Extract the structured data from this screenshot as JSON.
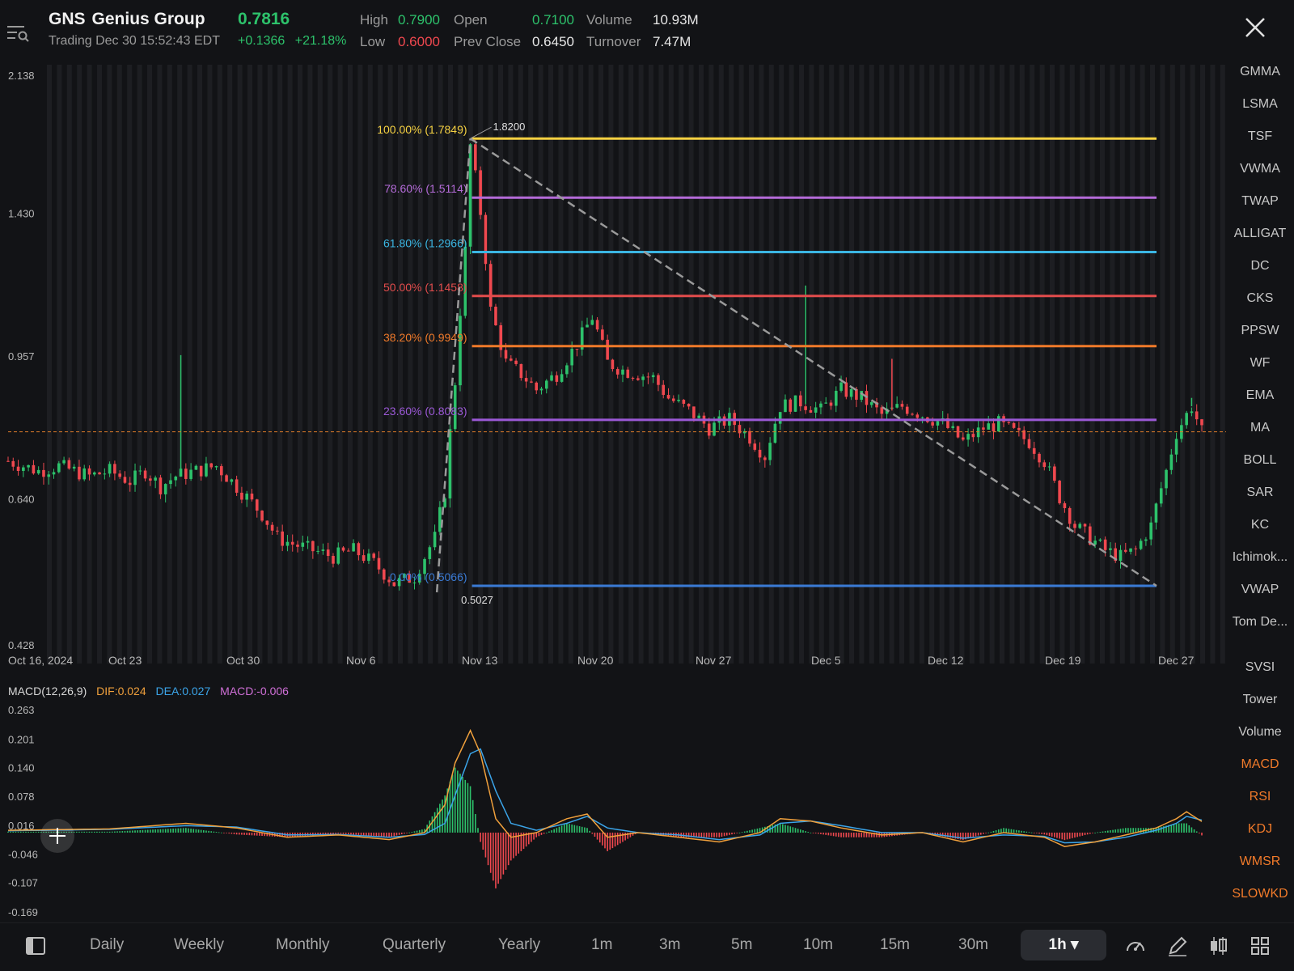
{
  "header": {
    "symbol": "GNS",
    "company": "Genius Group",
    "price": "0.7816",
    "status": "Trading Dec 30 15:52:43 EDT",
    "change": "+0.1366",
    "change_pct": "+21.18%",
    "high_label": "High",
    "high": "0.7900",
    "low_label": "Low",
    "low": "0.6000",
    "open_label": "Open",
    "open": "0.7100",
    "prev_close_label": "Prev Close",
    "prev_close": "0.6450",
    "volume_label": "Volume",
    "volume": "10.93M",
    "turnover_label": "Turnover",
    "turnover": "7.47M"
  },
  "chart_data": [
    {
      "type": "candlestick",
      "y_axis_ticks": [
        "2.138",
        "1.430",
        "0.957",
        "0.640",
        "0.428"
      ],
      "y_axis_tick_values": [
        2.138,
        1.43,
        0.957,
        0.64,
        0.428
      ],
      "log_scale": true,
      "ylim": [
        0.428,
        2.138
      ],
      "x_axis_ticks": [
        "Oct 16, 2024",
        "Oct 23",
        "Oct 30",
        "Nov 6",
        "Nov 13",
        "Nov 20",
        "Nov 27",
        "Dec 5",
        "Dec 12",
        "Dec 19",
        "Dec 27"
      ],
      "current_price_line": 0.7816,
      "fibonacci": [
        {
          "label": "100.00% (1.7849)",
          "value": 1.7849,
          "color": "#f5d142"
        },
        {
          "label": "78.60% (1.5114)",
          "value": 1.5114,
          "color": "#b46bd8"
        },
        {
          "label": "61.80% (1.2966)",
          "value": 1.2966,
          "color": "#3bb6e3"
        },
        {
          "label": "50.00% (1.1458)",
          "value": 1.1458,
          "color": "#e24c4c"
        },
        {
          "label": "38.20% (0.9949)",
          "value": 0.9949,
          "color": "#f07a2a"
        },
        {
          "label": "23.60% (0.8083)",
          "value": 0.8083,
          "color": "#9b59d6"
        },
        {
          "label": "0.00% (0.5066)",
          "value": 0.5066,
          "color": "#3a7bd5"
        }
      ],
      "swing_high_label": "1.8200",
      "swing_low_label": "0.5027",
      "price_path": [
        [
          0,
          0.72
        ],
        [
          6,
          0.7
        ],
        [
          10,
          0.71
        ],
        [
          16,
          0.69
        ],
        [
          20,
          0.7
        ],
        [
          24,
          0.68
        ],
        [
          27,
          0.7
        ],
        [
          30,
          0.67
        ],
        [
          33,
          0.69
        ],
        [
          37,
          0.7
        ],
        [
          41,
          0.71
        ],
        [
          44,
          0.68
        ],
        [
          47,
          0.65
        ],
        [
          50,
          0.62
        ],
        [
          53,
          0.58
        ],
        [
          56,
          0.57
        ],
        [
          60,
          0.56
        ],
        [
          64,
          0.55
        ],
        [
          68,
          0.56
        ],
        [
          72,
          0.54
        ],
        [
          76,
          0.51
        ],
        [
          80,
          0.52
        ],
        [
          84,
          0.58
        ],
        [
          86,
          0.66
        ],
        [
          88,
          0.9
        ],
        [
          90,
          1.3
        ],
        [
          91,
          1.75
        ],
        [
          93,
          1.45
        ],
        [
          95,
          1.1
        ],
        [
          98,
          0.95
        ],
        [
          101,
          0.92
        ],
        [
          104,
          0.88
        ],
        [
          108,
          0.92
        ],
        [
          112,
          1.0
        ],
        [
          115,
          1.08
        ],
        [
          118,
          0.95
        ],
        [
          121,
          0.93
        ],
        [
          124,
          0.92
        ],
        [
          127,
          0.91
        ],
        [
          130,
          0.86
        ],
        [
          134,
          0.83
        ],
        [
          138,
          0.79
        ],
        [
          142,
          0.81
        ],
        [
          146,
          0.77
        ],
        [
          149,
          0.73
        ],
        [
          152,
          0.84
        ],
        [
          156,
          0.85
        ],
        [
          160,
          0.83
        ],
        [
          164,
          0.88
        ],
        [
          168,
          0.86
        ],
        [
          172,
          0.82
        ],
        [
          176,
          0.84
        ],
        [
          180,
          0.82
        ],
        [
          184,
          0.8
        ],
        [
          188,
          0.76
        ],
        [
          192,
          0.79
        ],
        [
          195,
          0.8
        ],
        [
          198,
          0.78
        ],
        [
          201,
          0.76
        ],
        [
          204,
          0.72
        ],
        [
          207,
          0.65
        ],
        [
          210,
          0.6
        ],
        [
          213,
          0.58
        ],
        [
          216,
          0.56
        ],
        [
          219,
          0.55
        ],
        [
          222,
          0.56
        ],
        [
          225,
          0.6
        ],
        [
          228,
          0.7
        ],
        [
          230,
          0.78
        ],
        [
          233,
          0.84
        ],
        [
          235,
          0.7816
        ]
      ],
      "spikes": [
        [
          34,
          0.97
        ],
        [
          157,
          1.18
        ],
        [
          174,
          0.96
        ],
        [
          233,
          0.86
        ]
      ]
    },
    {
      "type": "macd",
      "indicator": "MACD(12,26,9)",
      "dif_label": "DIF:0.024",
      "dea_label": "DEA:0.027",
      "macd_label": "MACD:-0.006",
      "dif_color": "#f0a03c",
      "dea_color": "#3ba4e8",
      "macd_color": "#d070d8",
      "y_axis_ticks": [
        "0.263",
        "0.201",
        "0.140",
        "0.078",
        "0.016",
        "-0.046",
        "-0.107",
        "-0.169"
      ],
      "ylim": [
        -0.169,
        0.263
      ],
      "dif_path": [
        [
          0,
          0.005
        ],
        [
          20,
          0.008
        ],
        [
          35,
          0.02
        ],
        [
          45,
          0.01
        ],
        [
          55,
          -0.01
        ],
        [
          65,
          -0.005
        ],
        [
          75,
          -0.015
        ],
        [
          82,
          0.0
        ],
        [
          86,
          0.06
        ],
        [
          88,
          0.15
        ],
        [
          91,
          0.22
        ],
        [
          93,
          0.17
        ],
        [
          96,
          0.03
        ],
        [
          99,
          -0.01
        ],
        [
          104,
          0.0
        ],
        [
          110,
          0.03
        ],
        [
          114,
          0.04
        ],
        [
          118,
          -0.01
        ],
        [
          124,
          0.0
        ],
        [
          132,
          -0.01
        ],
        [
          140,
          -0.02
        ],
        [
          148,
          0.0
        ],
        [
          152,
          0.03
        ],
        [
          158,
          0.025
        ],
        [
          164,
          0.01
        ],
        [
          172,
          -0.005
        ],
        [
          180,
          0.0
        ],
        [
          188,
          -0.02
        ],
        [
          196,
          0.0
        ],
        [
          204,
          -0.01
        ],
        [
          208,
          -0.03
        ],
        [
          214,
          -0.02
        ],
        [
          220,
          -0.005
        ],
        [
          226,
          0.01
        ],
        [
          230,
          0.03
        ],
        [
          232,
          0.045
        ],
        [
          235,
          0.024
        ]
      ],
      "dea_path": [
        [
          0,
          0.004
        ],
        [
          20,
          0.007
        ],
        [
          35,
          0.015
        ],
        [
          45,
          0.012
        ],
        [
          55,
          -0.005
        ],
        [
          65,
          -0.004
        ],
        [
          75,
          -0.01
        ],
        [
          82,
          -0.004
        ],
        [
          86,
          0.02
        ],
        [
          88,
          0.08
        ],
        [
          91,
          0.17
        ],
        [
          93,
          0.18
        ],
        [
          96,
          0.09
        ],
        [
          99,
          0.02
        ],
        [
          104,
          0.005
        ],
        [
          110,
          0.02
        ],
        [
          114,
          0.035
        ],
        [
          118,
          0.01
        ],
        [
          124,
          0.0
        ],
        [
          132,
          -0.005
        ],
        [
          140,
          -0.015
        ],
        [
          148,
          -0.005
        ],
        [
          152,
          0.02
        ],
        [
          158,
          0.025
        ],
        [
          164,
          0.015
        ],
        [
          172,
          0.0
        ],
        [
          180,
          0.0
        ],
        [
          188,
          -0.012
        ],
        [
          196,
          -0.005
        ],
        [
          204,
          -0.008
        ],
        [
          208,
          -0.022
        ],
        [
          214,
          -0.02
        ],
        [
          220,
          -0.01
        ],
        [
          226,
          0.005
        ],
        [
          230,
          0.02
        ],
        [
          232,
          0.035
        ],
        [
          235,
          0.027
        ]
      ]
    }
  ],
  "right_panel": {
    "items": [
      {
        "label": "GMMA",
        "active": false
      },
      {
        "label": "LSMA",
        "active": false
      },
      {
        "label": "TSF",
        "active": false
      },
      {
        "label": "VWMA",
        "active": false
      },
      {
        "label": "TWAP",
        "active": false
      },
      {
        "label": "ALLIGAT",
        "active": false
      },
      {
        "label": "DC",
        "active": false
      },
      {
        "label": "CKS",
        "active": false
      },
      {
        "label": "PPSW",
        "active": false
      },
      {
        "label": "WF",
        "active": false
      },
      {
        "label": "EMA",
        "active": false
      },
      {
        "label": "MA",
        "active": false
      },
      {
        "label": "BOLL",
        "active": false
      },
      {
        "label": "SAR",
        "active": false
      },
      {
        "label": "KC",
        "active": false
      },
      {
        "label": "Ichimok...",
        "active": false
      },
      {
        "label": "VWAP",
        "active": false
      },
      {
        "label": "Tom De...",
        "active": false
      },
      {
        "label": "SVSI",
        "active": false
      },
      {
        "label": "Tower",
        "active": false
      },
      {
        "label": "Volume",
        "active": false
      },
      {
        "label": "MACD",
        "active": true
      },
      {
        "label": "RSI",
        "active": true
      },
      {
        "label": "KDJ",
        "active": true
      },
      {
        "label": "WMSR",
        "active": true
      },
      {
        "label": "SLOWKD",
        "active": true
      }
    ]
  },
  "bottom_bar": {
    "timeframes": [
      "Daily",
      "Weekly",
      "Monthly",
      "Quarterly",
      "Yearly",
      "1m",
      "3m",
      "5m",
      "10m",
      "15m",
      "30m"
    ],
    "active_timeframe": "1h ▾",
    "icons": [
      "layout-toggle-icon",
      "speedometer-icon",
      "pencil-icon",
      "candle-style-icon",
      "grid-icon"
    ]
  },
  "colors": {
    "up": "#2dc26b",
    "down": "#f0484f",
    "background": "#121316",
    "stripe": "#1d1e22",
    "trendline": "#9a9a9a"
  }
}
